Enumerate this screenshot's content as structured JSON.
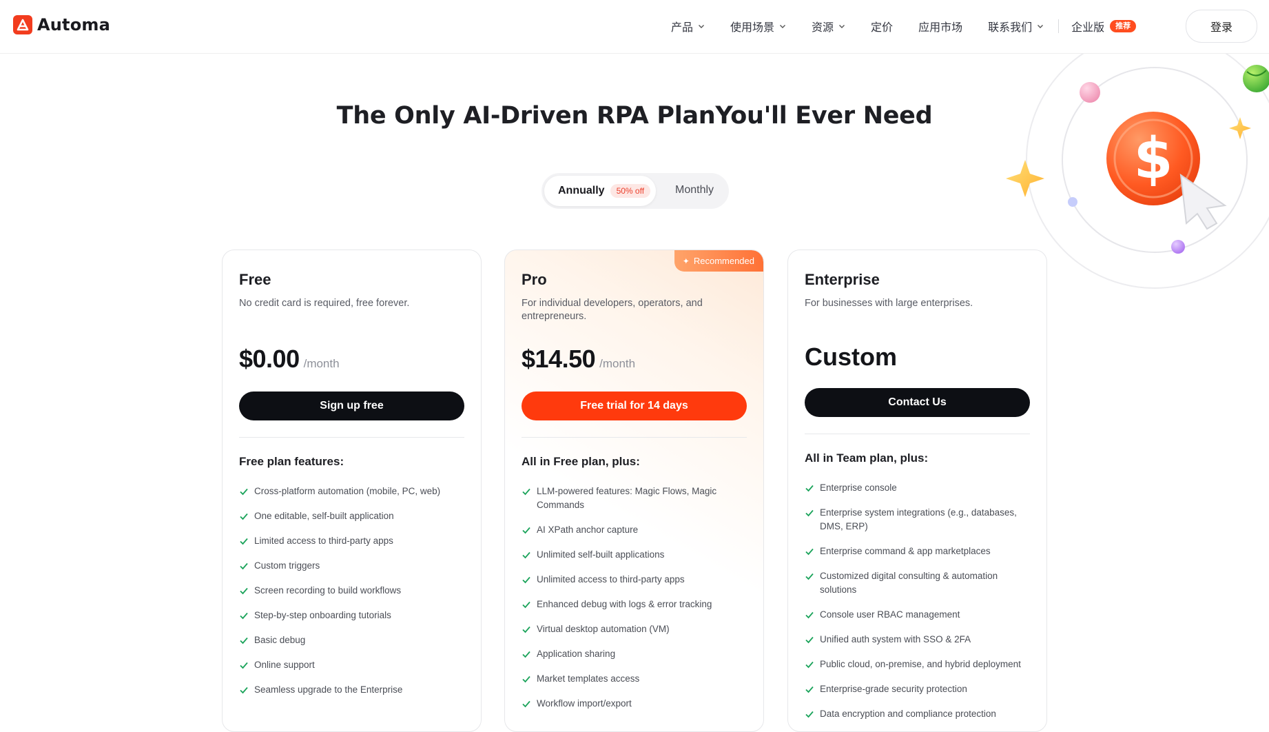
{
  "header": {
    "logo_text": "Automa",
    "nav": [
      {
        "label": "产品",
        "dropdown": true
      },
      {
        "label": "使用场景",
        "dropdown": true
      },
      {
        "label": "资源",
        "dropdown": true
      },
      {
        "label": "定价",
        "dropdown": false
      },
      {
        "label": "应用市场",
        "dropdown": false
      },
      {
        "label": "联系我们",
        "dropdown": true
      }
    ],
    "enterprise_label": "企业版",
    "enterprise_badge": "推荐",
    "login_label": "登录"
  },
  "hero": {
    "title": "The Only AI-Driven RPA PlanYou'll Ever Need"
  },
  "billing_toggle": {
    "annual_label": "Annually",
    "annual_discount": "50% off",
    "monthly_label": "Monthly",
    "selected": "annually"
  },
  "plans": {
    "free": {
      "name": "Free",
      "description": "No credit card is required, free forever.",
      "price": "$0.00",
      "period": "/month",
      "cta": "Sign up free",
      "features_heading": "Free plan features:",
      "features": [
        "Cross-platform automation (mobile, PC, web)",
        "One editable, self-built application",
        "Limited access to third-party apps",
        "Custom triggers",
        "Screen recording to build workflows",
        "Step-by-step onboarding tutorials",
        "Basic debug",
        "Online support",
        "Seamless upgrade to the Enterprise"
      ]
    },
    "pro": {
      "name": "Pro",
      "badge": "Recommended",
      "description": "For individual developers, operators, and entrepreneurs.",
      "price": "$14.50",
      "period": "/month",
      "cta": "Free trial for 14 days",
      "features_heading": "All in Free plan, plus:",
      "features": [
        "LLM-powered features: Magic Flows, Magic Commands",
        "AI XPath anchor capture",
        "Unlimited self-built applications",
        "Unlimited access to third-party apps",
        "Enhanced debug with logs & error tracking",
        "Virtual desktop automation (VM)",
        "Application sharing",
        "Market templates access",
        "Workflow import/export"
      ]
    },
    "enterprise": {
      "name": "Enterprise",
      "description": "For businesses with large enterprises.",
      "price": "Custom",
      "cta": "Contact Us",
      "features_heading": "All in Team plan, plus:",
      "features": [
        "Enterprise console",
        "Enterprise system integrations (e.g., databases, DMS, ERP)",
        "Enterprise command & app marketplaces",
        "Customized digital consulting & automation solutions",
        "Console user RBAC management",
        "Unified auth system with SSO & 2FA",
        "Public cloud, on-premise, and hybrid deployment",
        "Enterprise-grade security protection",
        "Data encryption and compliance protection"
      ]
    }
  },
  "colors": {
    "accent": "#ff3a0d",
    "dark_button": "#0d0f14",
    "check": "#1aa35a",
    "discount_text": "#ec3f2b"
  },
  "icons": {
    "check": "check-icon",
    "chevron": "chevron-down-icon",
    "decoration": "dollar-coin-illustration"
  }
}
